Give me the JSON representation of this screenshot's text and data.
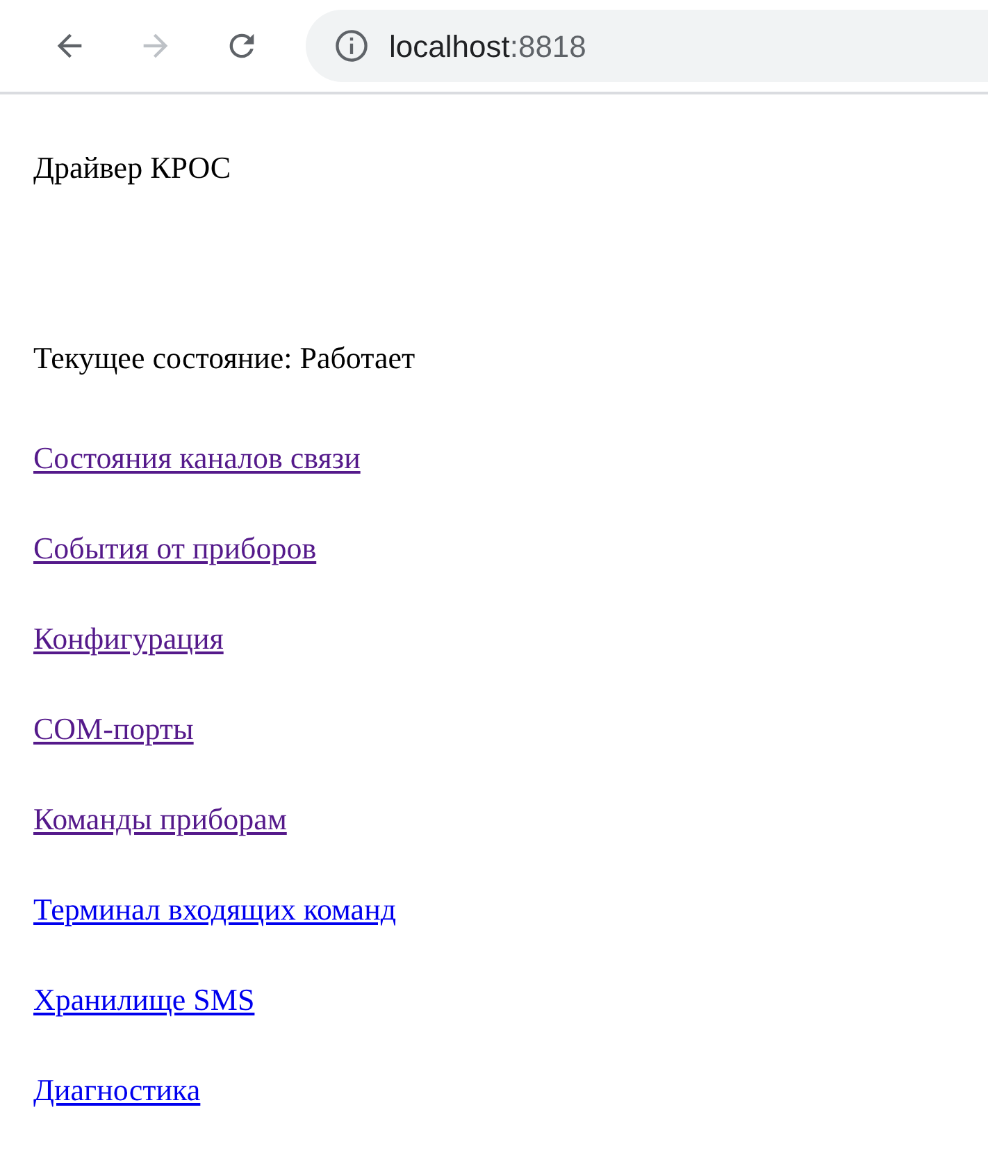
{
  "browser": {
    "back_disabled": false,
    "forward_disabled": true,
    "url_host": "localhost",
    "url_port": ":8818"
  },
  "title": "Драйвер КРОС",
  "status": "Текущее состояние: Работает",
  "links": [
    {
      "label": "Состояния каналов связи",
      "visited": true
    },
    {
      "label": "События от приборов",
      "visited": true
    },
    {
      "label": "Конфигурация",
      "visited": true
    },
    {
      "label": "COM-порты",
      "visited": true
    },
    {
      "label": "Команды приборам",
      "visited": true
    },
    {
      "label": "Терминал входящих команд",
      "visited": false
    },
    {
      "label": "Хранилище SMS",
      "visited": false
    },
    {
      "label": "Диагностика",
      "visited": false
    }
  ]
}
